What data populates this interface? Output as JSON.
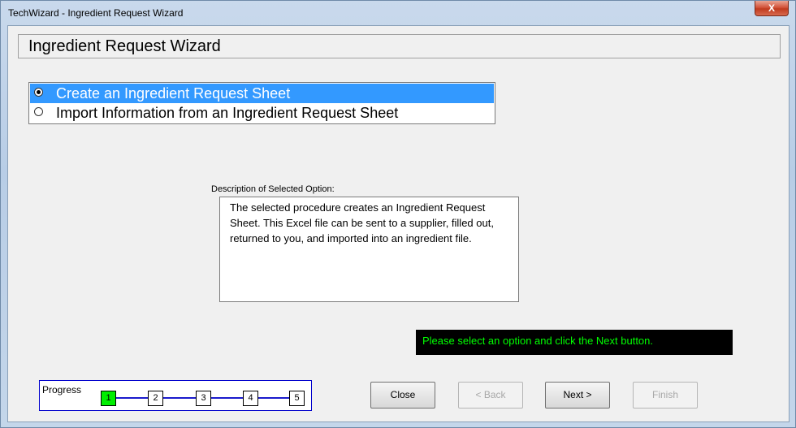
{
  "window": {
    "title": "TechWizard - Ingredient Request Wizard",
    "close_glyph": "X"
  },
  "header": {
    "title": "Ingredient Request Wizard"
  },
  "options": [
    {
      "label": "Create an Ingredient Request Sheet",
      "selected": true
    },
    {
      "label": "Import Information from an Ingredient Request Sheet",
      "selected": false
    }
  ],
  "description": {
    "label": "Description of Selected Option:",
    "text": "The selected procedure creates an Ingredient Request Sheet. This Excel file can be sent to a supplier, filled out, returned to you, and imported into an ingredient file."
  },
  "status": {
    "message": "Please select an option and click the Next button."
  },
  "progress": {
    "label": "Progress",
    "steps": [
      "1",
      "2",
      "3",
      "4",
      "5"
    ],
    "current_step": 1,
    "active_color": "#00ee00"
  },
  "buttons": {
    "close": {
      "label": "Close",
      "enabled": true
    },
    "back": {
      "label": "< Back",
      "enabled": false
    },
    "next": {
      "label": "Next >",
      "enabled": true
    },
    "finish": {
      "label": "Finish",
      "enabled": false
    }
  },
  "colors": {
    "selection": "#3399ff",
    "status_bg": "#000000",
    "status_text": "#00ff00"
  }
}
